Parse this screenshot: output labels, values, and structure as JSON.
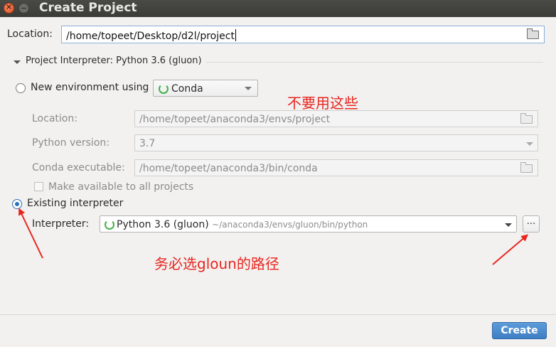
{
  "window": {
    "title": "Create Project"
  },
  "location": {
    "label": "Location:",
    "value": "/home/topeet/Desktop/d2l/project"
  },
  "section": {
    "title": "Project Interpreter: Python 3.6 (gluon)"
  },
  "new_env": {
    "radio_label": "New environment using",
    "tool": "Conda",
    "location_label": "Location:",
    "location_value": "/home/topeet/anaconda3/envs/project",
    "python_version_label": "Python version:",
    "python_version_value": "3.7",
    "conda_exec_label": "Conda executable:",
    "conda_exec_value": "/home/topeet/anaconda3/bin/conda",
    "make_available_label": "Make available to all projects"
  },
  "existing": {
    "radio_label": "Existing interpreter",
    "interpreter_label": "Interpreter:",
    "interpreter_name": "Python 3.6 (gluon)",
    "interpreter_path": "~/anaconda3/envs/gluon/bin/python",
    "browse_label": "..."
  },
  "annotations": {
    "note_top": "不要用这些",
    "note_bottom": "务必选gloun的路径",
    "color": "#e8261f"
  },
  "footer": {
    "create_label": "Create"
  },
  "colors": {
    "accent": "#3e7ec4",
    "conda_green": "#43b049"
  }
}
